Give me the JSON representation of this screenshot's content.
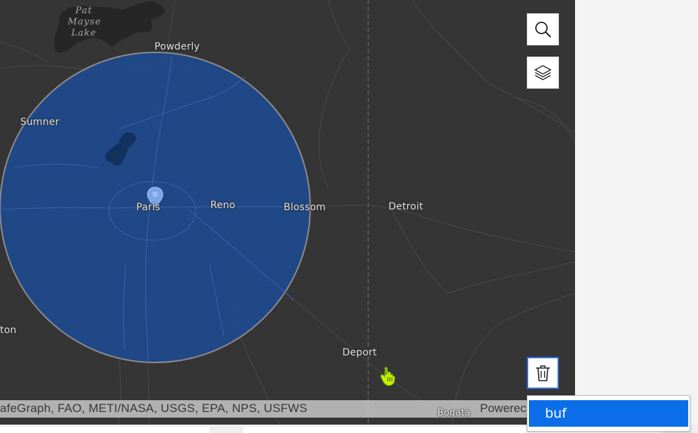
{
  "map": {
    "lake_label": "Pat Mayse Lake",
    "cities": [
      {
        "id": "powderly",
        "name": "Powderly"
      },
      {
        "id": "sumner",
        "name": "Sumner"
      },
      {
        "id": "paris",
        "name": "Paris"
      },
      {
        "id": "reno",
        "name": "Reno"
      },
      {
        "id": "blossom",
        "name": "Blossom"
      },
      {
        "id": "detroit",
        "name": "Detroit"
      },
      {
        "id": "deport",
        "name": "Deport"
      },
      {
        "id": "ton",
        "name": "ton"
      },
      {
        "id": "bogata",
        "name": "Bogata"
      }
    ],
    "buffer_color": "#1f4a8e",
    "basemap_color": "#353535"
  },
  "controls": {
    "search_icon": "search-icon",
    "layers_icon": "layers-icon",
    "delete_icon": "trash-icon"
  },
  "attribution": {
    "text": "afeGraph, FAO, METI/NASA, USGS, EPA, NPS, USFWS",
    "powered": "Powerec"
  },
  "suggestions": {
    "items": [
      {
        "label": "buf"
      }
    ]
  },
  "colors": {
    "accent": "#0b6ee8",
    "focus_border": "#2f6fd6"
  }
}
